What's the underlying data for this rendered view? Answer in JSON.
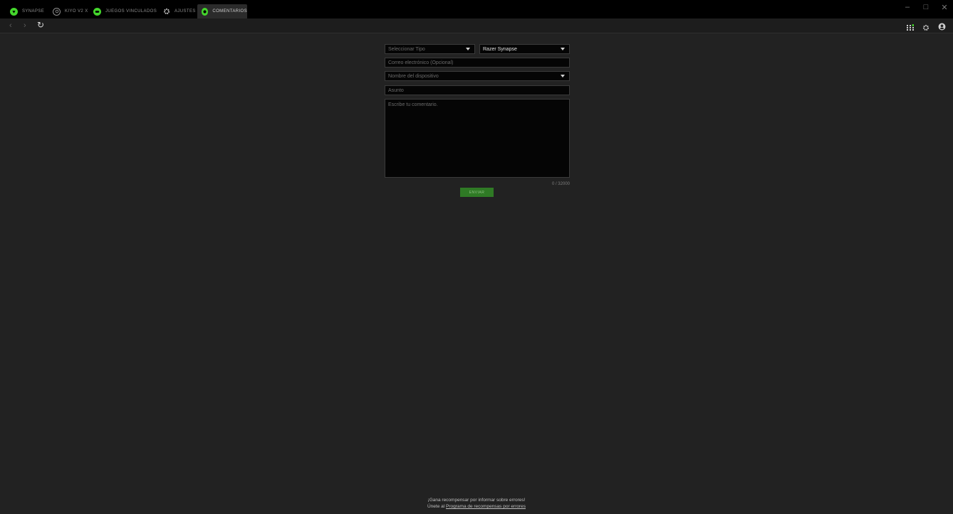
{
  "tabs": [
    {
      "label": "Synapse",
      "icon": "razer-icon",
      "active": false
    },
    {
      "label": "Kiyo V2 X",
      "icon": "webcam-icon",
      "active": false
    },
    {
      "label": "Juegos vinculados",
      "icon": "gamepad-icon",
      "active": false
    },
    {
      "label": "Ajustes",
      "icon": "gear-icon",
      "active": false
    },
    {
      "label": "Comentarios",
      "icon": "feedback-icon",
      "active": true
    }
  ],
  "window_controls": {
    "minimize": "–",
    "maximize": "□",
    "close": "✕"
  },
  "nav": {
    "back": "‹",
    "forward": "›",
    "refresh": "↻"
  },
  "form": {
    "type_placeholder": "Seleccionar Tipo",
    "product_value": "Razer Synapse",
    "email_placeholder": "Correo electrónico (Opcional)",
    "device_placeholder": "Nombre del dispositivo",
    "subject_placeholder": "Asunto",
    "comment_placeholder": "Escribe tu comentario.",
    "counter": "0 / 32000",
    "submit_label": "Enviar"
  },
  "footer": {
    "line1": "¡Gana recompensar por informar sobre errores!",
    "line2_prefix": "Únete al ",
    "line2_link": "Programa de recompensas por errores"
  },
  "colors": {
    "accent": "#44d62c",
    "background": "#222222",
    "tabbar": "#000000"
  }
}
